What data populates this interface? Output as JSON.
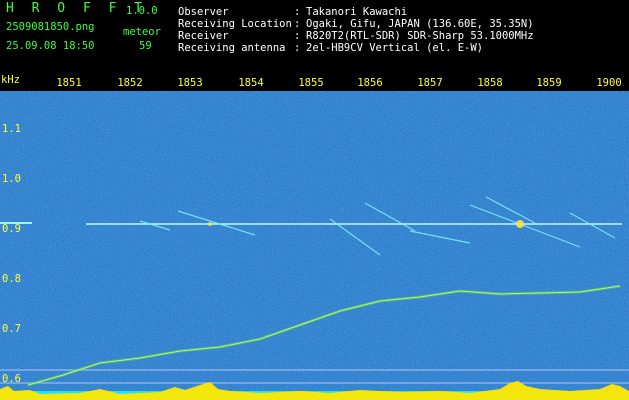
{
  "app": {
    "title": "H R O F F T",
    "version": "1.0.0"
  },
  "file": {
    "name": "2509081850.png",
    "datetime": "25.09.08 18:50"
  },
  "counter": {
    "label": "meteor",
    "value": "59"
  },
  "info": {
    "rows": [
      {
        "key": "Observer",
        "value": "Takanori Kawachi"
      },
      {
        "key": "Receiving Location",
        "value": "Ogaki, Gifu, JAPAN (136.60E, 35.35N)"
      },
      {
        "key": "Receiver",
        "value": "R820T2(RTL-SDR) SDR-Sharp 53.1000MHz"
      },
      {
        "key": "Receiving antenna",
        "value": "2el-HB9CV Vertical (el. E-W)"
      }
    ],
    "separator": ":"
  },
  "axes": {
    "y_unit": "kHz",
    "x_ticks": [
      "1851",
      "1852",
      "1853",
      "1854",
      "1855",
      "1856",
      "1857",
      "1858",
      "1859",
      "1900"
    ],
    "y_ticks": [
      "1.1",
      "1.0",
      "0.9",
      "0.8",
      "0.7",
      "0.6"
    ]
  },
  "colors": {
    "background": "#000000",
    "plot_bg": "#0b1a78",
    "text": "#ffffff",
    "title_green": "#39ff3e",
    "tick_yellow": "#ffff3a",
    "bottom_cyan": "#18e6ff",
    "bottom_yellow": "#ffe800"
  }
}
